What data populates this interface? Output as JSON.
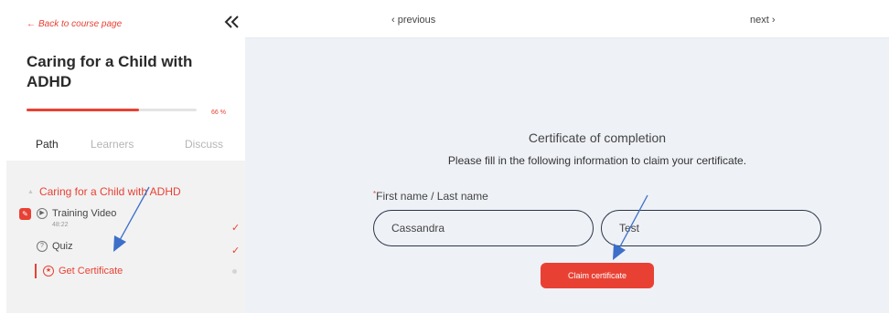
{
  "sidebar": {
    "back_link": "Back to course page",
    "course_title": "Caring for a Child with ADHD",
    "progress": {
      "value": 0.66,
      "label": "66 %"
    },
    "tabs": [
      {
        "label": "Path",
        "active": true
      },
      {
        "label": "Learners",
        "active": false
      },
      {
        "label": "Discuss",
        "active": false
      }
    ],
    "module": {
      "title": "Caring for a Child with ADHD",
      "lessons": [
        {
          "label": "Training Video",
          "duration": "48:22",
          "icon": "play-circle-icon",
          "status": "done"
        },
        {
          "label": "Quiz",
          "icon": "question-circle-icon",
          "status": "done"
        },
        {
          "label": "Get Certificate",
          "icon": "award-icon",
          "status": "current"
        }
      ]
    }
  },
  "topbar": {
    "previous": "‹ previous",
    "next": "next ›"
  },
  "main": {
    "title": "Certificate of completion",
    "subtitle": "Please fill in the following information to claim your certificate.",
    "field_label": "First name / Last name",
    "first_name": "Cassandra",
    "last_name": "Test",
    "claim_button": "Claim certificate"
  },
  "colors": {
    "accent": "#e84134",
    "main_bg": "#eef1f6",
    "sidebar_list_bg": "#f2f2f2",
    "annotation": "#3b6fc9"
  }
}
